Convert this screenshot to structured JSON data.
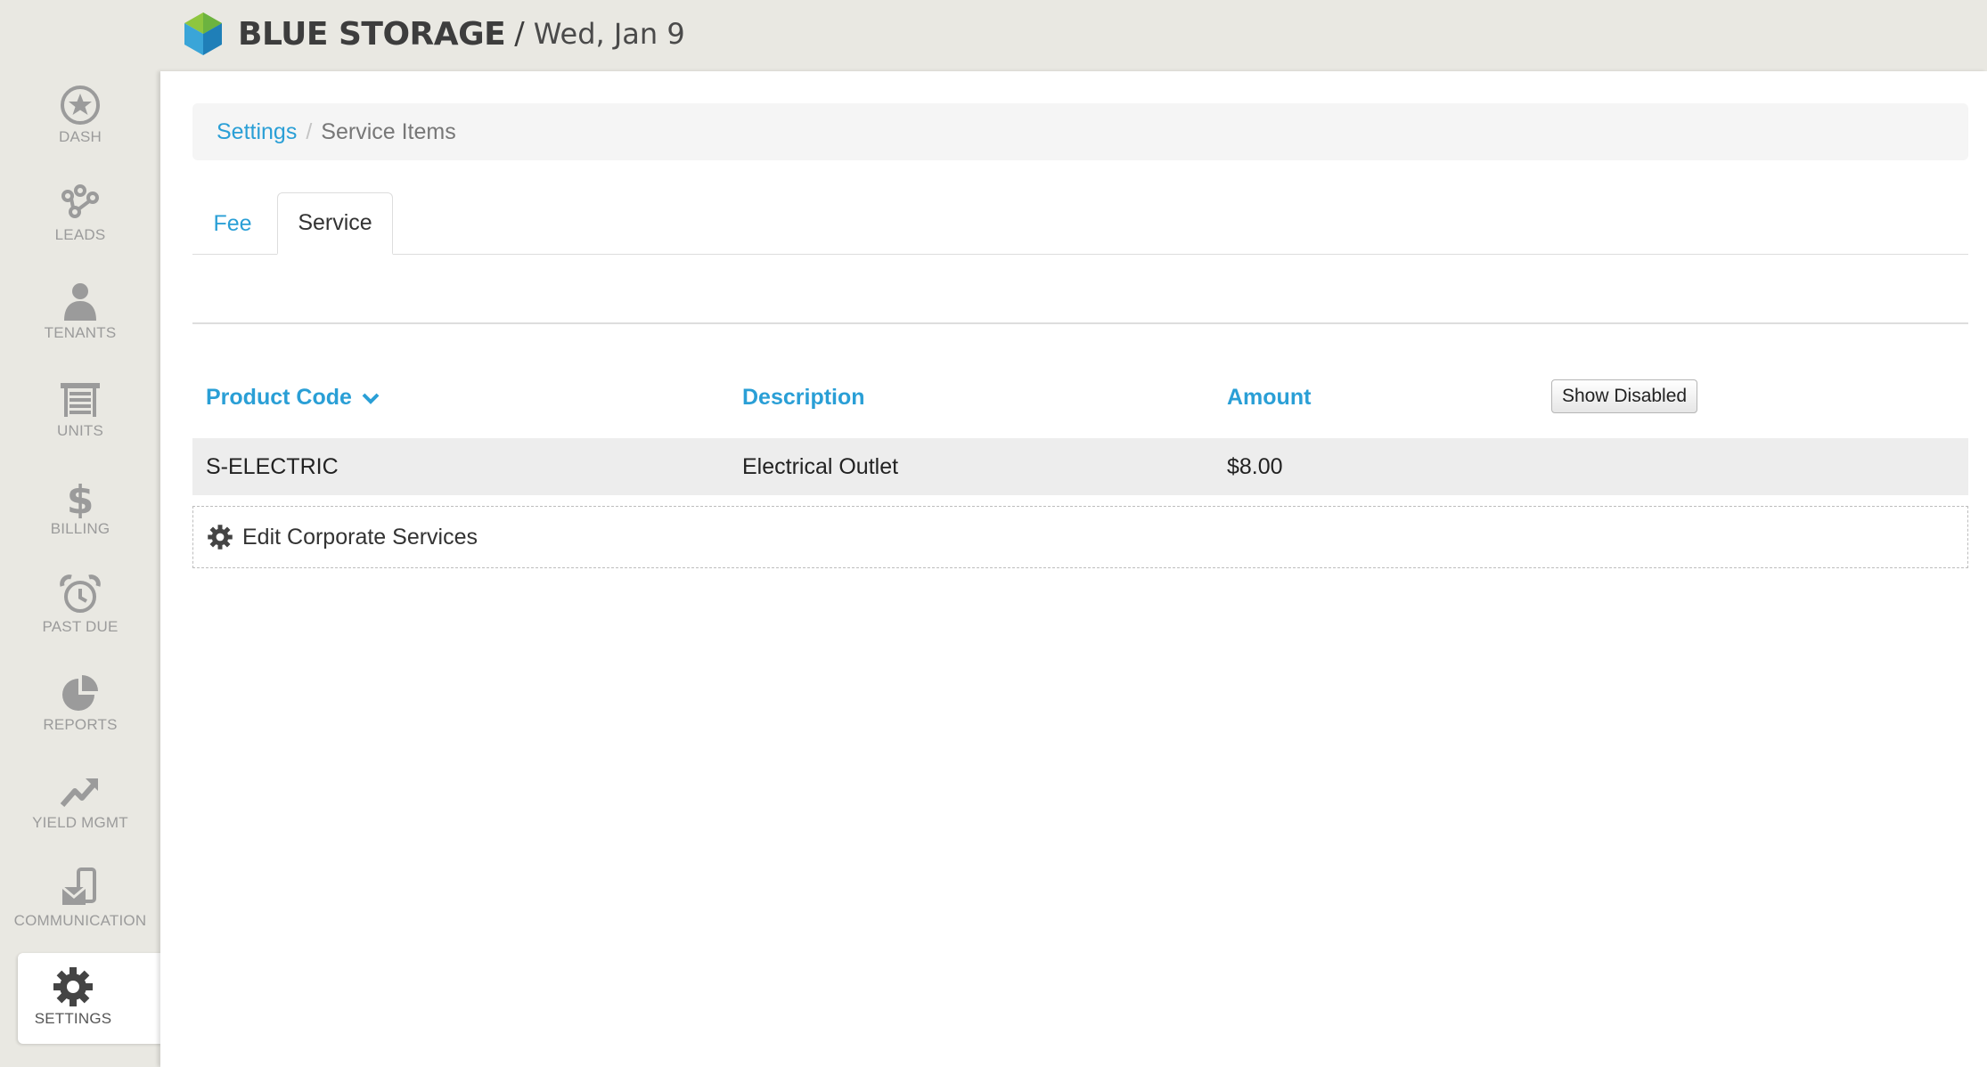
{
  "header": {
    "brand": "BLUE STORAGE",
    "separator": "/",
    "date": "Wed, Jan 9"
  },
  "sidebar": {
    "items": [
      {
        "label": "DASH",
        "icon": "star-circle-icon"
      },
      {
        "label": "LEADS",
        "icon": "network-icon"
      },
      {
        "label": "TENANTS",
        "icon": "person-icon"
      },
      {
        "label": "UNITS",
        "icon": "garage-door-icon"
      },
      {
        "label": "BILLING",
        "icon": "dollar-icon"
      },
      {
        "label": "PAST DUE",
        "icon": "alarm-clock-icon"
      },
      {
        "label": "REPORTS",
        "icon": "pie-chart-icon"
      },
      {
        "label": "YIELD MGMT",
        "icon": "trend-up-icon"
      },
      {
        "label": "COMMUNICATION",
        "icon": "phone-mail-icon"
      },
      {
        "label": "SETTINGS",
        "icon": "gear-icon",
        "active": true
      }
    ]
  },
  "breadcrumb": {
    "parent": "Settings",
    "separator": "/",
    "current": "Service Items"
  },
  "tabs": {
    "fee": "Fee",
    "service": "Service",
    "active": "Service"
  },
  "table": {
    "headers": {
      "code": "Product Code",
      "description": "Description",
      "amount": "Amount"
    },
    "show_disabled_label": "Show Disabled",
    "rows": [
      {
        "code": "S-ELECTRIC",
        "description": "Electrical Outlet",
        "amount": "$8.00"
      }
    ]
  },
  "edit_corporate_label": "Edit Corporate Services",
  "colors": {
    "accent": "#2a9fd6",
    "sidebar_bg": "#e9e8e2",
    "icon_gray": "#9b9b9b",
    "row_bg": "#ededed"
  }
}
